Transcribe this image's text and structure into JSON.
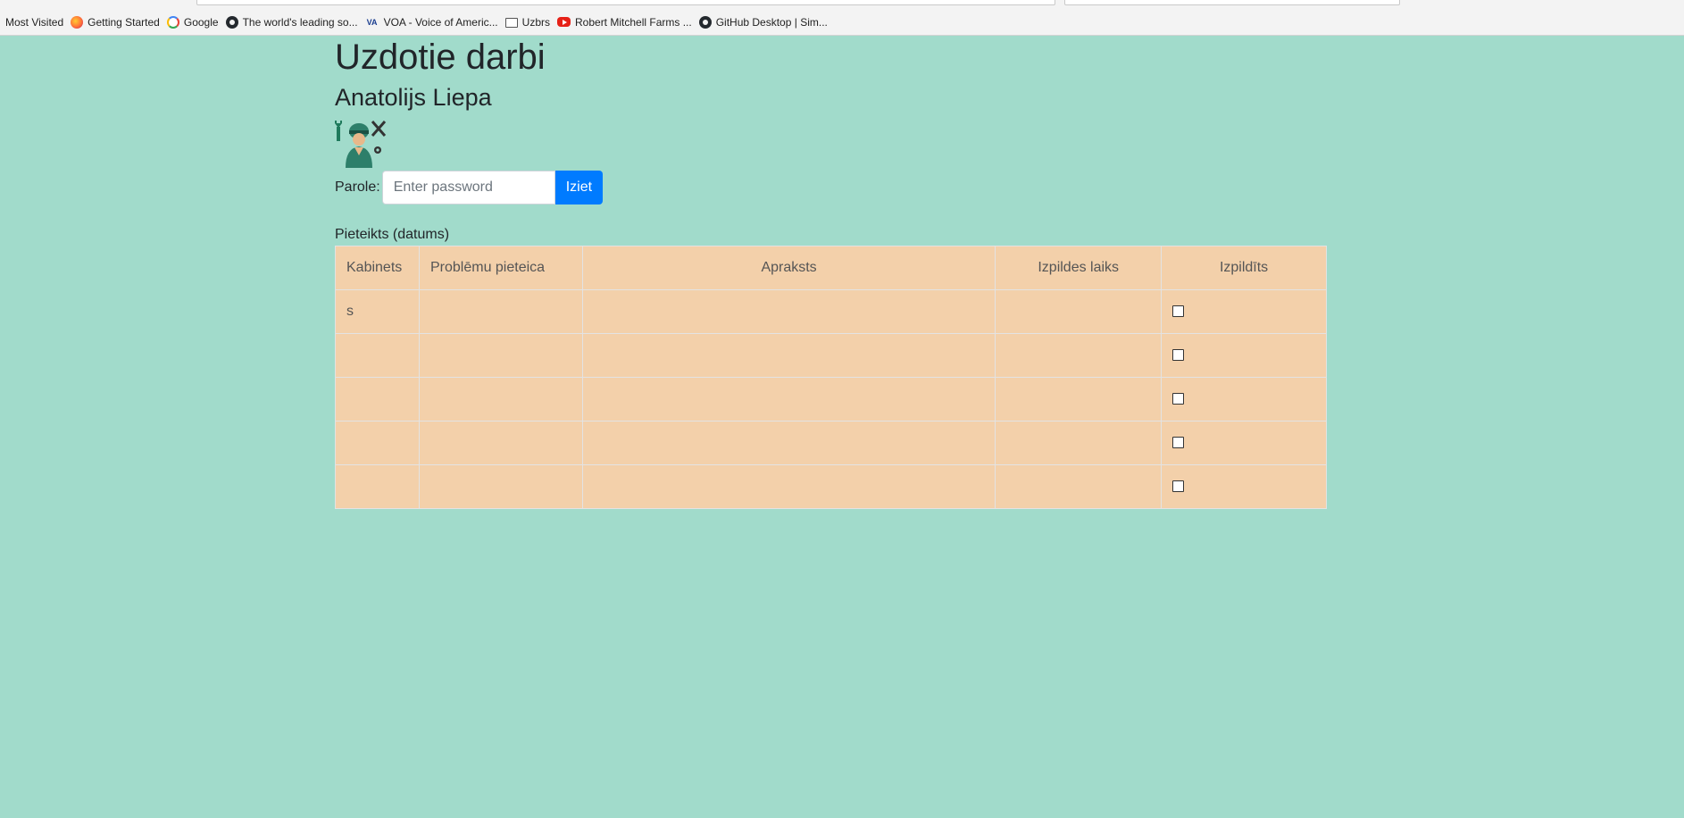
{
  "bookmarks": [
    {
      "label": "Most Visited",
      "icon": "none"
    },
    {
      "label": "Getting Started",
      "icon": "firefox-icon"
    },
    {
      "label": "Google",
      "icon": "google-icon"
    },
    {
      "label": "The world's leading so...",
      "icon": "github-icon"
    },
    {
      "label": "VOA - Voice of Americ...",
      "icon": "voa-icon"
    },
    {
      "label": "Uzbrs",
      "icon": "folder-icon"
    },
    {
      "label": "Robert Mitchell Farms ...",
      "icon": "youtube-icon"
    },
    {
      "label": "GitHub Desktop | Sim...",
      "icon": "github-icon"
    }
  ],
  "page": {
    "title": "Uzdotie darbi",
    "user_name": "Anatolijs Liepa",
    "password_label": "Parole:",
    "password_placeholder": "Enter password",
    "logout_label": "Iziet",
    "section_label": "Pieteikts (datums)"
  },
  "table": {
    "headers": [
      "Kabinets",
      "Problēmu pieteica",
      "Apraksts",
      "Izpildes laiks",
      "Izpildīts"
    ],
    "rows": [
      {
        "kabinets": "s",
        "pieteica": "",
        "apraksts": "",
        "laiks": "",
        "izpildits": false
      },
      {
        "kabinets": "",
        "pieteica": "",
        "apraksts": "",
        "laiks": "",
        "izpildits": false
      },
      {
        "kabinets": "",
        "pieteica": "",
        "apraksts": "",
        "laiks": "",
        "izpildits": false
      },
      {
        "kabinets": "",
        "pieteica": "",
        "apraksts": "",
        "laiks": "",
        "izpildits": false
      },
      {
        "kabinets": "",
        "pieteica": "",
        "apraksts": "",
        "laiks": "",
        "izpildits": false
      }
    ]
  },
  "colors": {
    "page_background": "#a1dbcb",
    "table_background": "#f3d0aa",
    "button_primary": "#007bff"
  }
}
